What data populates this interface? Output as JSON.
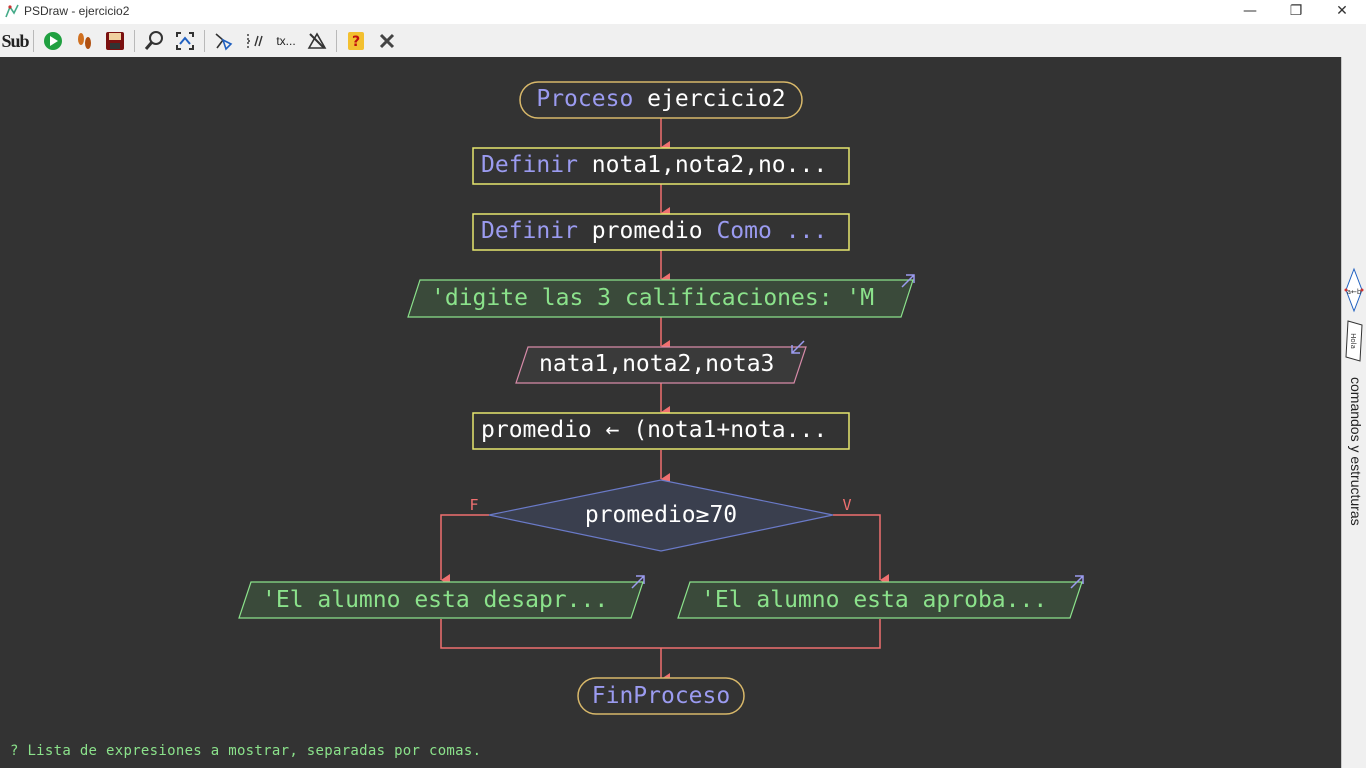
{
  "window": {
    "title": "PSDraw - ejercicio2",
    "minimize_glyph": "—",
    "restore_glyph": "❐",
    "close_glyph": "✕"
  },
  "toolbar": {
    "items": [
      {
        "name": "sub",
        "icon": "sub-icon",
        "text": "Sub"
      },
      {
        "name": "run",
        "icon": "play-icon"
      },
      {
        "name": "step",
        "icon": "footsteps-icon"
      },
      {
        "name": "save",
        "icon": "floppy-icon"
      },
      {
        "name": "zoom",
        "icon": "magnifier-icon"
      },
      {
        "name": "fit",
        "icon": "fit-to-screen-icon"
      },
      {
        "name": "style",
        "icon": "flowchart-style-icon"
      },
      {
        "name": "comments",
        "icon": "comments-icon"
      },
      {
        "name": "truncate-text",
        "icon": "text-truncate-icon",
        "text": "tx..."
      },
      {
        "name": "hide-tracking",
        "icon": "tracking-icon"
      },
      {
        "name": "help",
        "icon": "help-icon"
      },
      {
        "name": "close",
        "icon": "close-icon"
      }
    ]
  },
  "flowchart": {
    "start": {
      "keyword": "Proceso",
      "name": "ejercicio2"
    },
    "define1": {
      "keyword": "Definir",
      "text": "nota1,nota2,no..."
    },
    "define2": {
      "keyword": "Definir",
      "var": "promedio",
      "kw2": "Como",
      "rest": "..."
    },
    "write1": {
      "text": "'digite las 3 calificaciones: 'M"
    },
    "read1": {
      "text": "nata1,nota2,nota3"
    },
    "assign": {
      "text": "promedio ← (nota1+nota..."
    },
    "decision": {
      "text": "promedio≥70",
      "false_label": "F",
      "true_label": "V"
    },
    "write_false": {
      "text": "'El alumno esta desapr..."
    },
    "write_true": {
      "text": "'El alumno esta aproba..."
    },
    "end": {
      "keyword": "FinProceso"
    }
  },
  "status_text": "? Lista de expresiones a mostrar, separadas por comas.",
  "side_panel": {
    "label": "comandos y estructuras",
    "mini1": "a←b",
    "mini2": "Hola"
  },
  "colors": {
    "canvas_bg": "#333333",
    "keyword": "#9b9bf0",
    "text": "#ffffff",
    "string": "#8be28b",
    "number": "#f0e68c",
    "arrow": "#f07070",
    "terminal_border": "#d8b86a",
    "process_border": "#e6e66e",
    "io_fill": "#3a4a3a"
  }
}
